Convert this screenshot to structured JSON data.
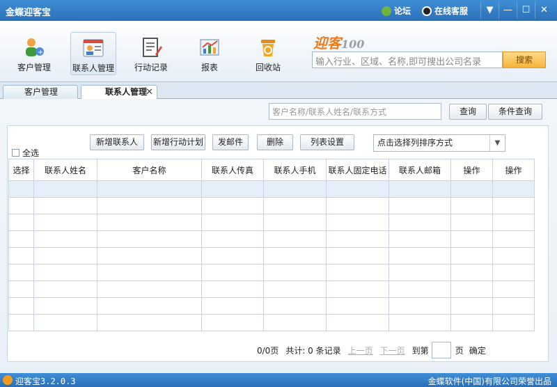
{
  "app": {
    "title": "金蝶迎客宝"
  },
  "titlebar": {
    "forum": "论坛",
    "service": "在线客服",
    "menu_glyph": "▼",
    "min_glyph": "—",
    "max_glyph": "☐",
    "close_glyph": "✕"
  },
  "toolbar": {
    "items": [
      {
        "label": "客户管理"
      },
      {
        "label": "联系人管理"
      },
      {
        "label": "行动记录"
      },
      {
        "label": "报表"
      },
      {
        "label": "回收站"
      }
    ],
    "logo_text": "迎客",
    "logo_num": "100",
    "search_placeholder": "输入行业、区域、名称,即可搜出公司名录",
    "search_button": "搜索"
  },
  "tabs": [
    {
      "label": "客户管理",
      "active": false
    },
    {
      "label": "联系人管理",
      "active": true
    }
  ],
  "query": {
    "placeholder": "客户名称/联系人姓名/联系方式",
    "query_button": "查询",
    "advanced_button": "条件查询"
  },
  "actions": {
    "new_contact": "新增联系人",
    "new_plan": "新增行动计划",
    "send_mail": "发邮件",
    "delete": "删除",
    "column_settings": "列表设置",
    "sort_select": "点击选择列排序方式",
    "select_all": "全选"
  },
  "table": {
    "columns": [
      "选择",
      "联系人姓名",
      "客户名称",
      "联系人传真",
      "联系人手机",
      "联系人固定电话",
      "联系人邮箱",
      "操作",
      "操作"
    ],
    "rows": 9
  },
  "pager": {
    "pages": "0/0页",
    "total": "共计: 0 条记录",
    "prev": "上一页",
    "next": "下一页",
    "goto": "到第",
    "page_unit": "页",
    "confirm": "确定"
  },
  "status": {
    "version": "迎客宝3.2.0.3",
    "copyright": "金蝶软件(中国)有限公司荣誉出品"
  },
  "colors": {
    "titlebar": "#2a6fb8",
    "search_button": "#f5b43a",
    "logo": "#f07a1a"
  }
}
